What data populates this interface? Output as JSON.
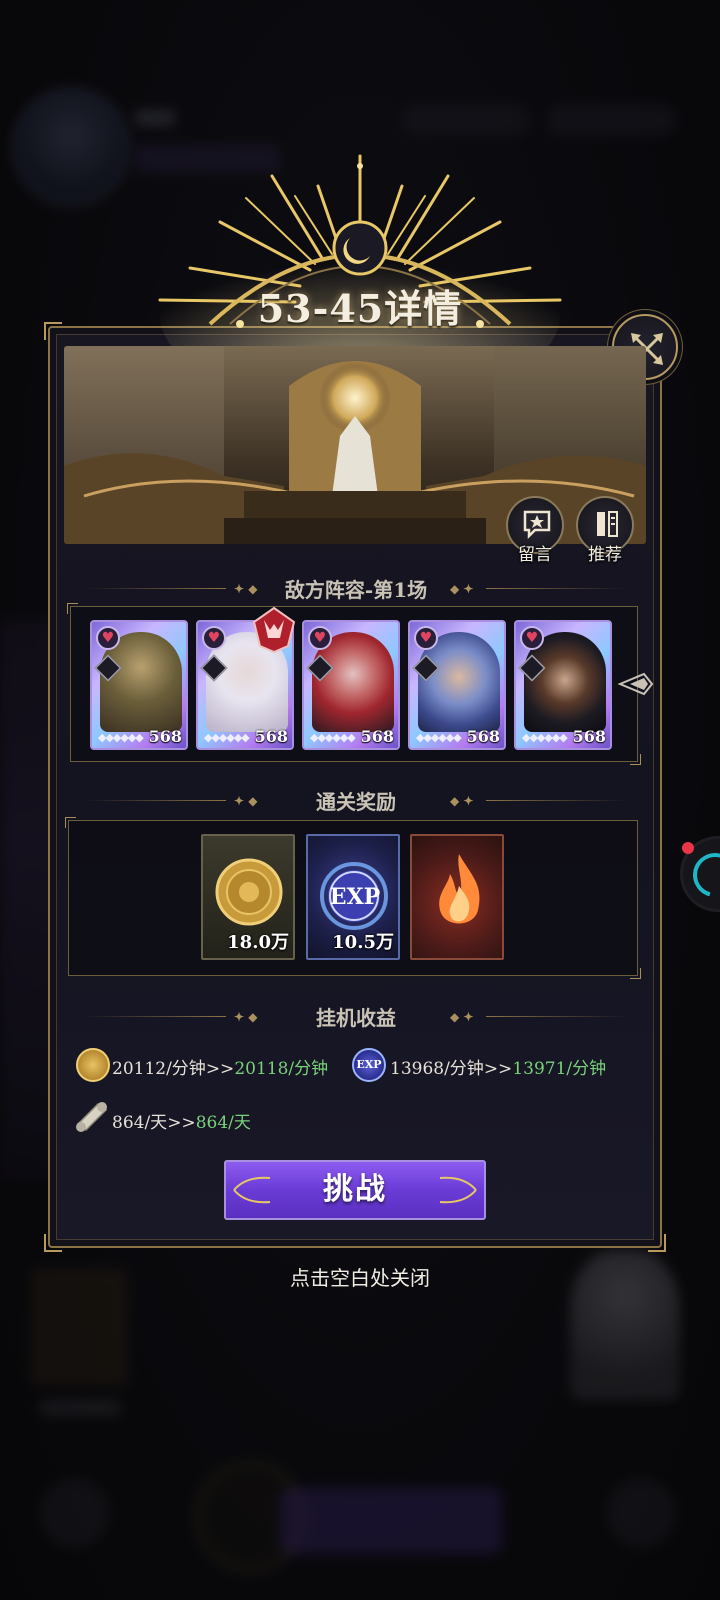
{
  "popup": {
    "title": "53-45详情",
    "close_hint": "点击空白处关闭"
  },
  "banner": {
    "message_label": "留言",
    "recommend_label": "推荐"
  },
  "enemy_section": {
    "title": "敌方阵容-第1场",
    "heroes": [
      {
        "level": "568",
        "stars": "◆◆◆◆◆◆",
        "hair": "#6b5f3a",
        "skin": "#b8a070"
      },
      {
        "level": "568",
        "stars": "◆◆◆◆◆◆",
        "hair": "#e8e4ef",
        "skin": "#e6d8d8"
      },
      {
        "level": "568",
        "stars": "◆◆◆◆◆◆",
        "hair": "#a0262e",
        "skin": "#e2c2c0"
      },
      {
        "level": "568",
        "stars": "◆◆◆◆◆◆",
        "hair": "#3c4a8c",
        "skin": "#d9b9a0"
      },
      {
        "level": "568",
        "stars": "◆◆◆◆◆◆",
        "hair": "#1c1a22",
        "skin": "#c9a68c"
      }
    ]
  },
  "rewards_section": {
    "title": "通关奖励",
    "items": [
      {
        "icon": "gold-coin-icon",
        "quantity": "18.0万"
      },
      {
        "icon": "exp-orb-icon",
        "quantity": "10.5万",
        "icon_text": "EXP"
      },
      {
        "icon": "flame-icon",
        "quantity": ""
      }
    ]
  },
  "idle_section": {
    "title": "挂机收益",
    "gold": {
      "current": "20112/分钟",
      "arrow": ">>",
      "next": "20118/分钟"
    },
    "exp": {
      "icon_text": "EXP",
      "current": "13968/分钟",
      "arrow": ">>",
      "next": "13971/分钟"
    },
    "scroll": {
      "current": "864/天",
      "arrow": ">>",
      "next": "864/天"
    }
  },
  "actions": {
    "challenge_label": "挑战"
  },
  "colors": {
    "gold": "#b79a5c",
    "purple_button": "#6a3cd6",
    "increase_green": "#79d27a"
  }
}
